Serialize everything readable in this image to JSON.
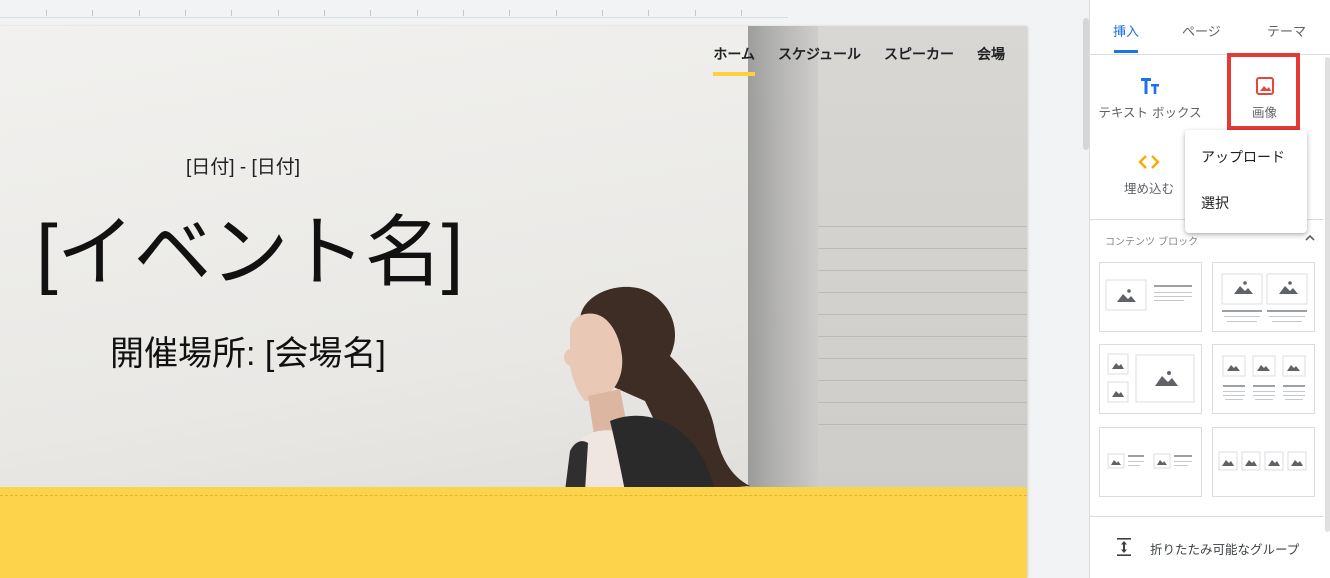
{
  "site": {
    "nav": [
      {
        "label": "ホーム",
        "active": true
      },
      {
        "label": "スケジュール",
        "active": false
      },
      {
        "label": "スピーカー",
        "active": false
      },
      {
        "label": "会場",
        "active": false
      }
    ],
    "date_text": "[日付] - [日付]",
    "event_name": "[イベント名]",
    "venue_text": "開催場所: [会場名]",
    "accent_color": "#fed34c"
  },
  "panel": {
    "tabs": [
      {
        "label": "挿入",
        "active": true
      },
      {
        "label": "ページ",
        "active": false
      },
      {
        "label": "テーマ",
        "active": false
      }
    ],
    "tools": {
      "text_box": "テキスト ボックス",
      "image": "画像",
      "embed": "埋め込む"
    },
    "image_menu": [
      "アップロード",
      "選択"
    ],
    "content_blocks_title": "コンテンツ ブロック",
    "collapsible_group": "折りたたみ可能なグループ"
  }
}
